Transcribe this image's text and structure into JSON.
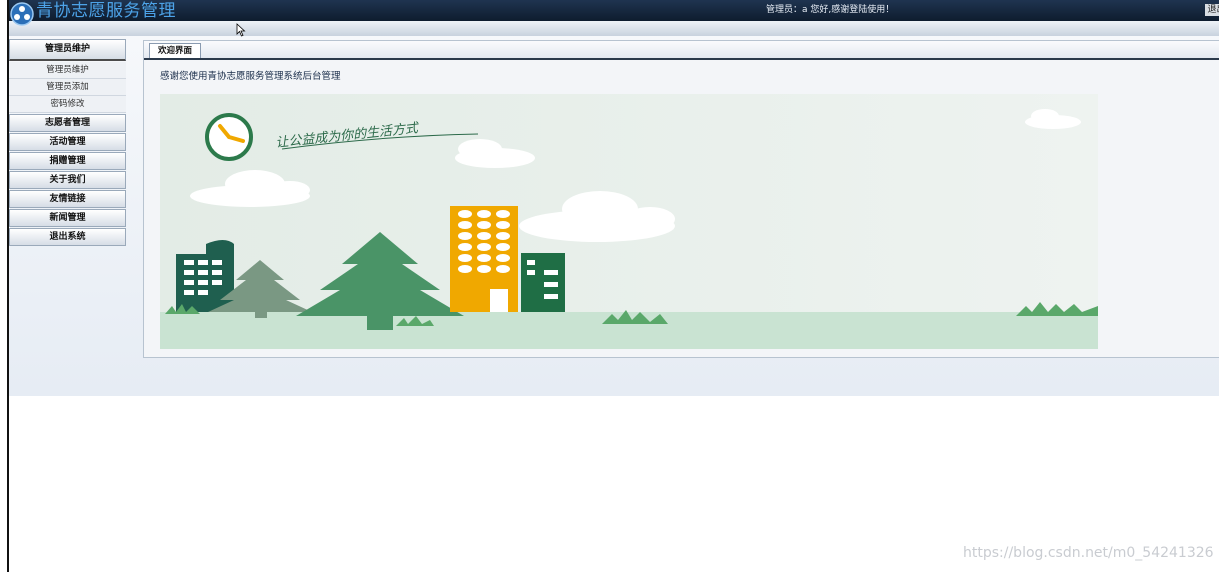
{
  "header": {
    "title": "青协志愿服务管理",
    "welcome_text": "管理员：a 您好,感谢登陆使用！",
    "logout_label": "退出"
  },
  "sidebar": {
    "sections": [
      {
        "label": "管理员维护",
        "items": [
          "管理员维护",
          "管理员添加",
          "密码修改"
        ]
      },
      {
        "label": "志愿者管理"
      },
      {
        "label": "活动管理"
      },
      {
        "label": "捐赠管理"
      },
      {
        "label": "关于我们"
      },
      {
        "label": "友情链接"
      },
      {
        "label": "新闻管理"
      },
      {
        "label": "退出系统"
      }
    ]
  },
  "main": {
    "tabs": [
      {
        "label": "欢迎界面"
      }
    ],
    "welcome_message": "感谢您使用青协志愿服务管理系统后台管理",
    "banner": {
      "slogan": "让公益成为你的生活方式",
      "colors": {
        "sky": "#e7efea",
        "ground": "#c9e3d2",
        "tree": "#4a9467",
        "building_orange": "#f0a800",
        "building_green": "#1f6e45",
        "building_dark": "#1f5f4f"
      }
    }
  },
  "watermark": "https://blog.csdn.net/m0_54241326",
  "colors": {
    "header_bg": "#142538",
    "title": "#4da3e8",
    "panel_border": "#b7c3d0"
  }
}
